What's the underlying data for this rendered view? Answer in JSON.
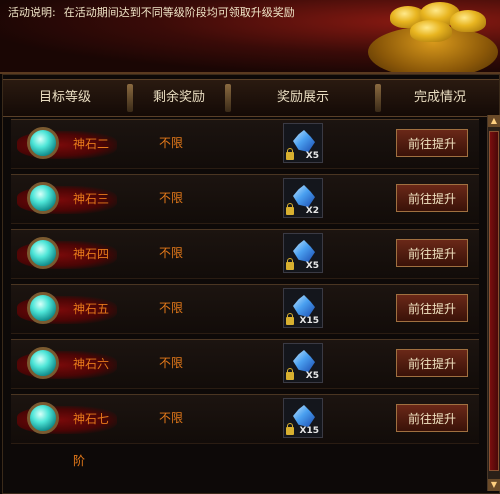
{
  "banner": {
    "label": "活动说明:",
    "text": "在活动期间达到不同等级阶段均可领取升级奖励"
  },
  "columns": [
    "目标等级",
    "剩余奖励",
    "奖励展示",
    "完成情况"
  ],
  "rows": [
    {
      "gem": "神石二阶",
      "remain": "不限",
      "count": "X5",
      "button": "前往提升"
    },
    {
      "gem": "神石三阶",
      "remain": "不限",
      "count": "X2",
      "button": "前往提升"
    },
    {
      "gem": "神石四阶",
      "remain": "不限",
      "count": "X5",
      "button": "前往提升"
    },
    {
      "gem": "神石五阶",
      "remain": "不限",
      "count": "X15",
      "button": "前往提升"
    },
    {
      "gem": "神石六阶",
      "remain": "不限",
      "count": "X5",
      "button": "前往提升"
    },
    {
      "gem": "神石七阶",
      "remain": "不限",
      "count": "X15",
      "button": "前往提升"
    }
  ],
  "icons": {
    "gem": "gem-icon",
    "reward": "crystal-icon",
    "lock": "lock-icon"
  },
  "colors": {
    "accent_text": "#e67a1a",
    "button_bg": "#5a1f12",
    "header_text": "#e8dcc0"
  }
}
